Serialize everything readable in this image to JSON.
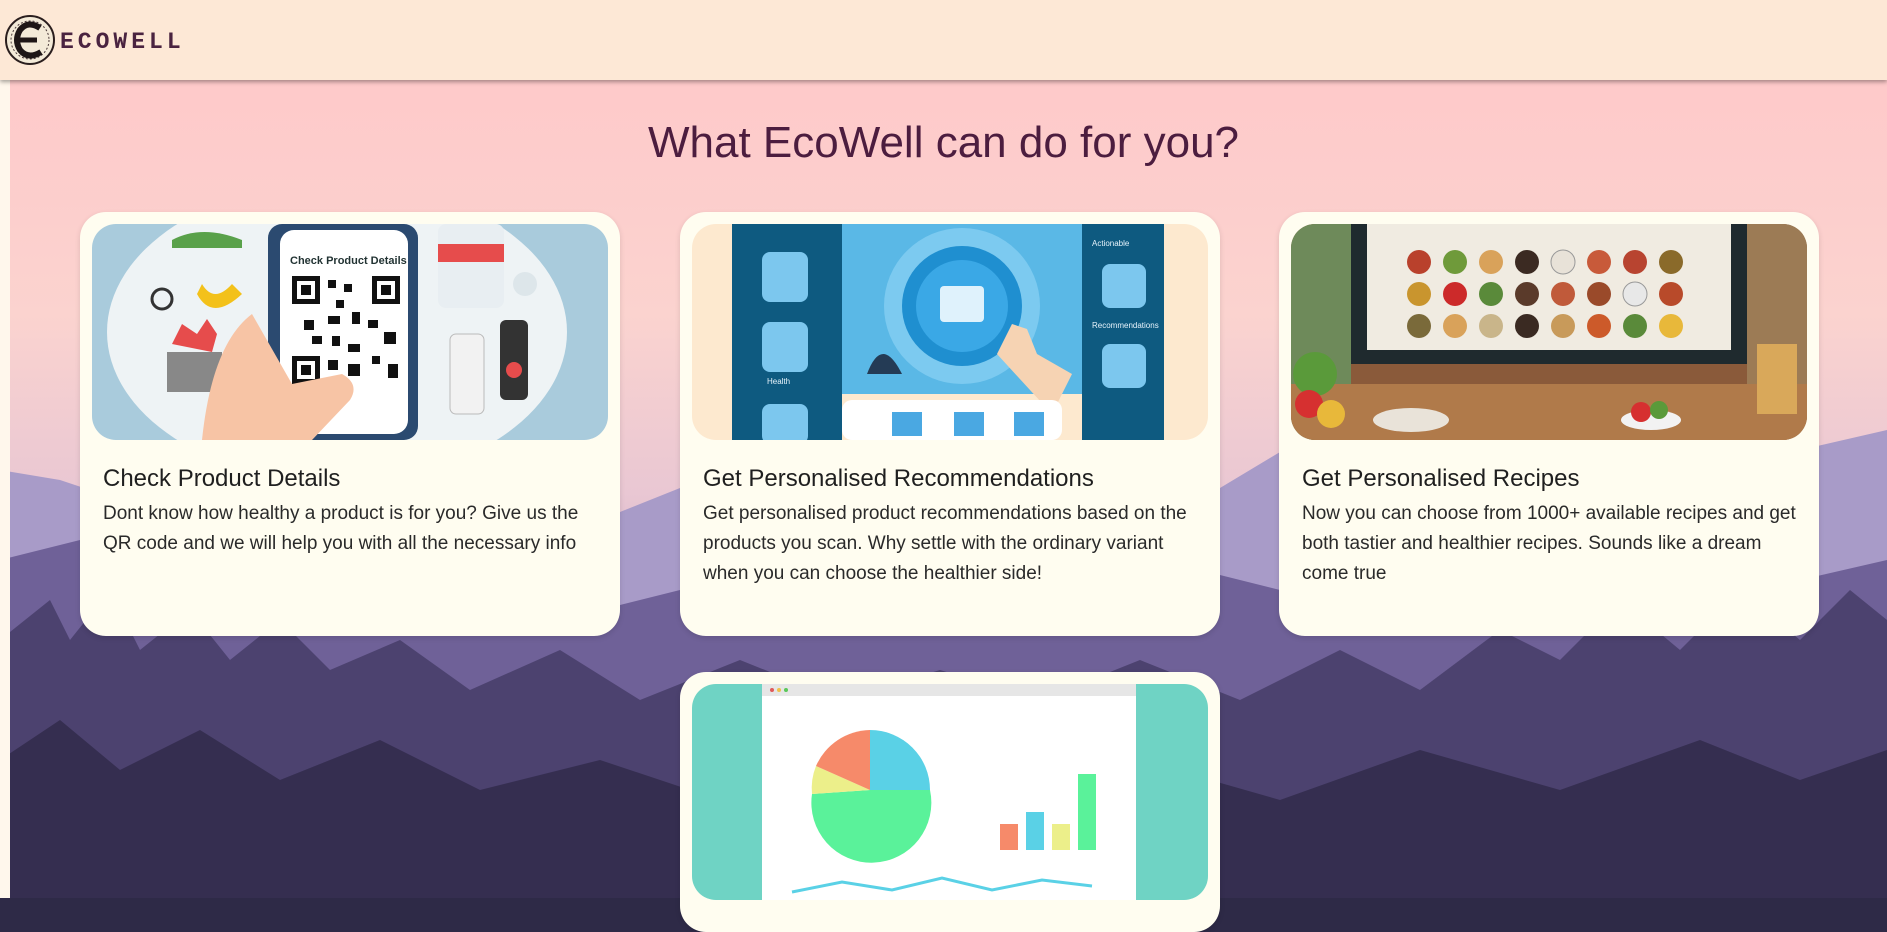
{
  "header": {
    "brand_text": "ECOWELL",
    "logo_icon": "ecowell-logo-icon"
  },
  "main": {
    "heading": "What EcoWell can do for you?",
    "cards": [
      {
        "title": "Check Product Details",
        "text": "Dont know how healthy a product is for you? Give us the QR code and we will help you with all the necessary info",
        "image_label": "Check Product Details"
      },
      {
        "title": "Get Personalised Recommendations",
        "text": "Get personalised product recommendations based on the products you scan. Why settle with the ordinary variant when you can choose the healthier side!",
        "image_labels": [
          "Actionable",
          "Recommendations",
          "Health"
        ]
      },
      {
        "title": "Get Personalised Recipes",
        "text": "Now you can choose from 1000+ available recipes and get both tastier and healthier recipes. Sounds like a dream come true"
      },
      {
        "title": "",
        "text": ""
      }
    ]
  },
  "colors": {
    "header_bg": "#fde8d6",
    "heading": "#4c1d3f",
    "card_bg": "#fffdf0",
    "sky_top": "#ffc8cc",
    "mountains": "#6b5a9a"
  }
}
